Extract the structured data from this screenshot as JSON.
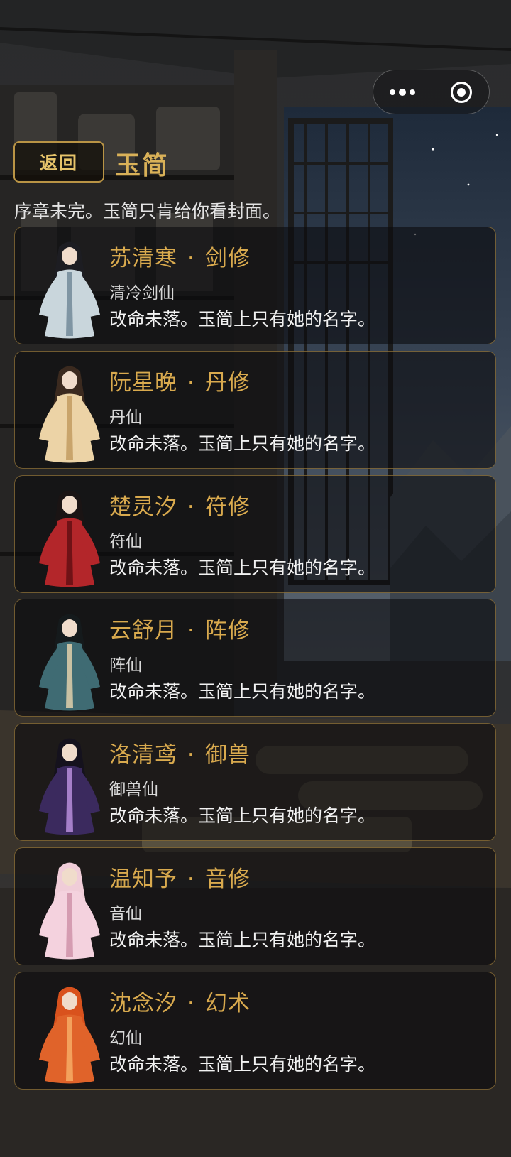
{
  "header": {
    "back_label": "返回",
    "title": "玉简",
    "subtitle": "序章未完。玉简只肯给你看封面。"
  },
  "capsule": {
    "more_icon": "more-dots-icon",
    "close_icon": "target-icon"
  },
  "cards": [
    {
      "name": "苏清寒",
      "sep": "·",
      "school": "剑修",
      "title": "清冷剑仙",
      "desc": "改命未落。玉简上只有她的名字。",
      "robe": "#c9d6dc",
      "trim": "#7f95a3",
      "hair": "#1d1d22"
    },
    {
      "name": "阮星晚",
      "sep": "·",
      "school": "丹修",
      "title": "丹仙",
      "desc": "改命未落。玉简上只有她的名字。",
      "robe": "#ecd3a6",
      "trim": "#c9a46b",
      "hair": "#3b2a1f"
    },
    {
      "name": "楚灵汐",
      "sep": "·",
      "school": "符修",
      "title": "符仙",
      "desc": "改命未落。玉简上只有她的名字。",
      "robe": "#b3262a",
      "trim": "#6f1216",
      "hair": "#1a1414"
    },
    {
      "name": "云舒月",
      "sep": "·",
      "school": "阵修",
      "title": "阵仙",
      "desc": "改命未落。玉简上只有她的名字。",
      "robe": "#3f6b73",
      "trim": "#c9c1a3",
      "hair": "#151a1c"
    },
    {
      "name": "洛清鸢",
      "sep": "·",
      "school": "御兽",
      "title": "御兽仙",
      "desc": "改命未落。玉简上只有她的名字。",
      "robe": "#3b2a5e",
      "trim": "#a57fc9",
      "hair": "#15121d"
    },
    {
      "name": "温知予",
      "sep": "·",
      "school": "音修",
      "title": "音仙",
      "desc": "改命未落。玉简上只有她的名字。",
      "robe": "#f4d2de",
      "trim": "#d59cb1",
      "hair": "#f0cdd8"
    },
    {
      "name": "沈念汐",
      "sep": "·",
      "school": "幻术",
      "title": "幻仙",
      "desc": "改命未落。玉简上只有她的名字。",
      "robe": "#e0632a",
      "trim": "#f3a15c",
      "hair": "#d9521d"
    }
  ]
}
